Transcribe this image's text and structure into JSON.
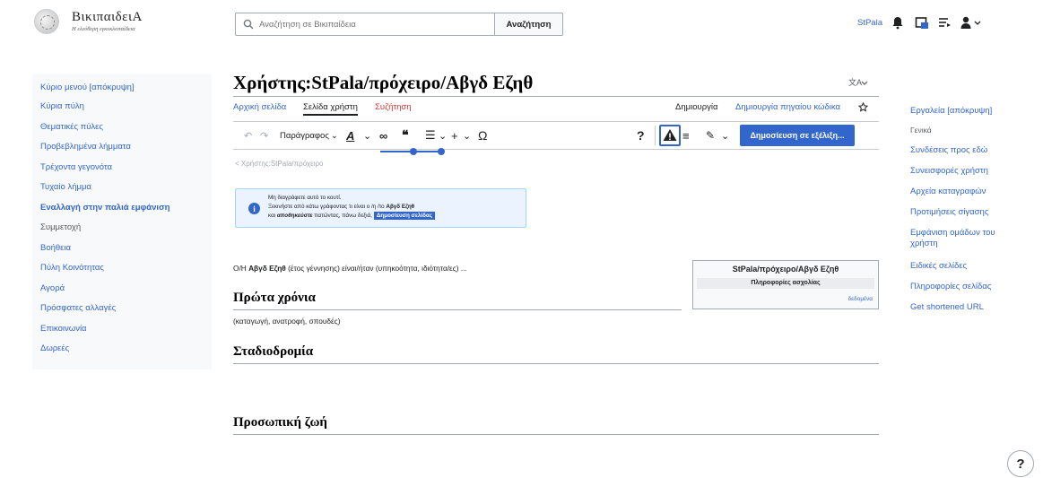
{
  "header": {
    "wordmark": "ΒικιπαιδειΑ",
    "tagline": "Η ελεύθερη εγκυκλοπαίδεια",
    "search_placeholder": "Αναζήτηση σε Βικιπαίδεια",
    "search_button": "Αναζήτηση",
    "username": "StPala"
  },
  "sidebar": {
    "items": [
      {
        "label": "Κύριο μενού [απόκρυψη]"
      },
      {
        "label": "Κύρια πύλη"
      },
      {
        "label": "Θεματικές πύλες"
      },
      {
        "label": "Προβεβλημένα λήμματα"
      },
      {
        "label": "Τρέχοντα γεγονότα"
      },
      {
        "label": "Τυχαίο λήμμα"
      },
      {
        "label": "Εναλλαγή στην παλιά εμφάνιση"
      },
      {
        "label": "Συμμετοχή"
      },
      {
        "label": "Βοήθεια"
      },
      {
        "label": "Πύλη Κοινότητας"
      },
      {
        "label": "Αγορά"
      },
      {
        "label": "Πρόσφατες αλλαγές"
      },
      {
        "label": "Επικοινωνία"
      },
      {
        "label": "Δωρεές"
      }
    ]
  },
  "page": {
    "title": "Χρήστης:StPala/πρόχειρο/Αβγδ Εζηθ",
    "tabs_left": [
      "Αρχική σελίδα",
      "Σελίδα χρήστη",
      "Συζήτηση"
    ],
    "tabs_right": [
      "Δημιουργία",
      "Δημιουργία πηγαίου κώδικα"
    ],
    "toolbar": {
      "paragraph": "Παράγραφος",
      "publish": "Δημοσίευση σε εξέλιξη..."
    },
    "breadcrumb": "< Χρήστης:StPala/πρόχειρο",
    "notice": {
      "line1": "Μη διαγράφετε αυτό το κουτί.",
      "line2_pre": "Ξεκινήστε από κάτω γράφοντας τι είναι ο /η /το ",
      "line2_bold": "Αβγδ Εζηθ",
      "line3_pre": "και ",
      "line3_bold": "αποθηκεύστε",
      "line3_post": " πατώντας, πάνω δεξιά,",
      "button": "Δημοσίευση σελίδας"
    },
    "intro_pre": "Ο/Η ",
    "intro_bold": "Αβγδ Εζηθ",
    "intro_post": " (έτος γέννησης) είναι/ήταν (υπηκοότητα, ιδιότητα/ες) ...",
    "sections": [
      {
        "heading": "Πρώτα χρόνια",
        "text": "(καταγωγή, ανατροφή, σπουδές)"
      },
      {
        "heading": "Σταδιοδρομία",
        "text": ""
      },
      {
        "heading": "Προσωπική ζωή",
        "text": ""
      }
    ],
    "infobox": {
      "title": "StPala/πρόχειρο/Αβγδ Εζηθ",
      "subtitle": "Πληροφορίες ασχολίας",
      "link": "δεδομένα"
    }
  },
  "tools": {
    "items": [
      {
        "label": "Εργαλεία [απόκρυψη]"
      },
      {
        "label": "Γενικά"
      },
      {
        "label": "Συνδέσεις προς εδώ"
      },
      {
        "label": "Συνεισφορές χρήστη"
      },
      {
        "label": "Αρχεία καταγραφών"
      },
      {
        "label": "Προτιμήσεις σίγασης"
      },
      {
        "label": "Εμφάνιση ομάδων του"
      },
      {
        "label": "χρήστη"
      },
      {
        "label": "Ειδικές σελίδες"
      },
      {
        "label": "Πληροφορίες σελίδας"
      },
      {
        "label": "Get shortened URL"
      }
    ]
  },
  "help_label": "?",
  "colors": {
    "link": "#3366cc",
    "accent": "#3366cc",
    "red_link": "#d73333"
  }
}
